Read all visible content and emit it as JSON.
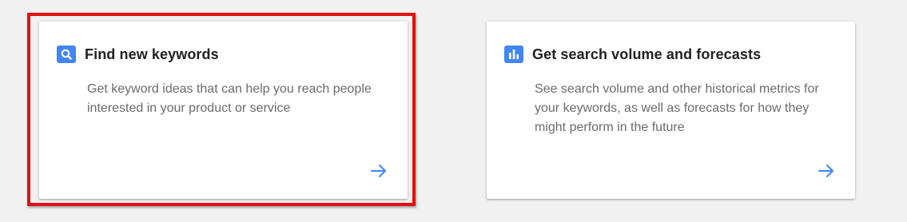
{
  "cards": [
    {
      "icon": "search-icon",
      "title": "Find new keywords",
      "description": "Get keyword ideas that can help you reach people interested in your product or service",
      "arrow": "arrow-right-icon"
    },
    {
      "icon": "bar-chart-icon",
      "title": "Get search volume and forecasts",
      "description": "See search volume and other historical metrics for your keywords, as well as forecasts for how they might perform in the future",
      "arrow": "arrow-right-icon"
    }
  ],
  "colors": {
    "accent": "#4285f4",
    "highlight": "#e01010",
    "title": "#202124",
    "description": "#6b6b6b",
    "background": "#f1f1f1"
  }
}
